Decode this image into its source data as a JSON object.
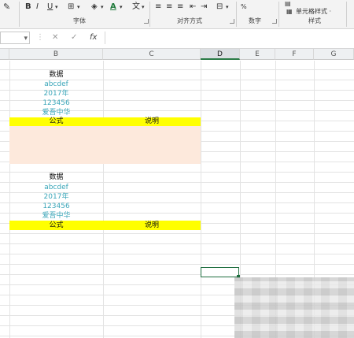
{
  "ribbon": {
    "font_buttons": [
      "B",
      "I",
      "U"
    ],
    "font_color_letter": "A",
    "groups": {
      "font": "字体",
      "alignment": "对齐方式",
      "number": "数字",
      "styles": "样式"
    },
    "cell_styles_label": "单元格样式 ·"
  },
  "formula_bar": {
    "cancel_glyph": "✕",
    "confirm_glyph": "✓",
    "fx_label": "fx",
    "value": ""
  },
  "columns": [
    {
      "label": "B",
      "selected": false
    },
    {
      "label": "C",
      "selected": false
    },
    {
      "label": "D",
      "selected": true
    },
    {
      "label": "E",
      "selected": false
    },
    {
      "label": "F",
      "selected": false
    },
    {
      "label": "G",
      "selected": false
    }
  ],
  "table1": {
    "title": "数据",
    "rows": [
      "abcdef",
      "2017年",
      "123456",
      "爱吾中华"
    ],
    "header_formula": "公式",
    "header_desc": "说明"
  },
  "table2": {
    "title": "数据",
    "rows": [
      "abcdef",
      "2017年",
      "123456",
      "爱吾中华"
    ],
    "header_formula": "公式",
    "header_desc": "说明"
  },
  "colors": {
    "highlight_yellow": "#ffff00",
    "peach_fill": "#fde9dc",
    "teal_text": "#3aa6b9",
    "selection_green": "#1f6e3f"
  }
}
